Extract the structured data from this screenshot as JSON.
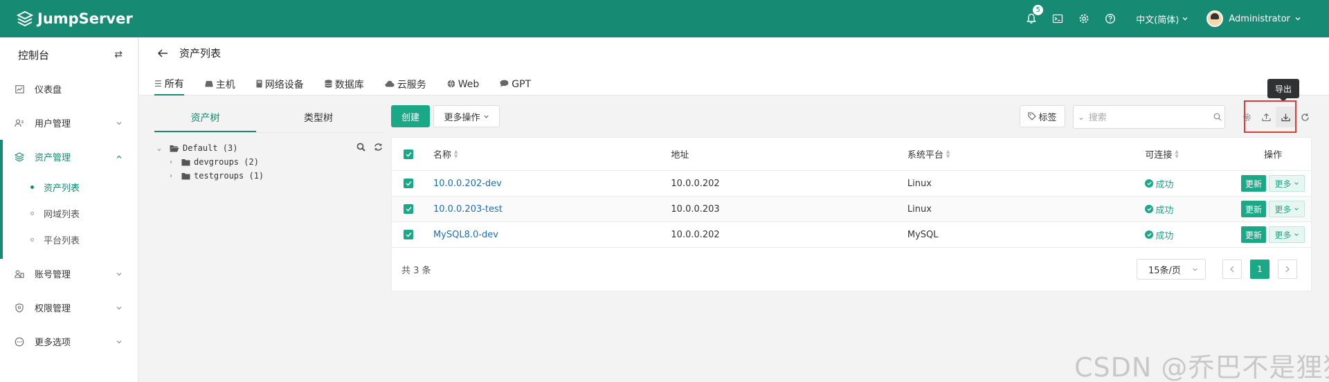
{
  "header": {
    "logo": "JumpServer",
    "notification_count": "5",
    "language": "中文(简体)",
    "user": "Administrator",
    "icons": [
      "bell-icon",
      "terminal-icon",
      "gear-icon",
      "help-icon"
    ]
  },
  "sidebar": {
    "title": "控制台",
    "items": [
      {
        "label": "仪表盘",
        "icon": "dashboard-icon"
      },
      {
        "label": "用户管理",
        "icon": "users-icon"
      },
      {
        "label": "资产管理",
        "icon": "assets-icon"
      },
      {
        "label": "账号管理",
        "icon": "accounts-icon"
      },
      {
        "label": "权限管理",
        "icon": "shield-icon"
      },
      {
        "label": "更多选项",
        "icon": "more-icon"
      }
    ],
    "sub_items": [
      {
        "label": "资产列表"
      },
      {
        "label": "网域列表"
      },
      {
        "label": "平台列表"
      }
    ]
  },
  "page": {
    "title": "资产列表",
    "tabs": [
      {
        "label": "所有"
      },
      {
        "label": "主机"
      },
      {
        "label": "网络设备"
      },
      {
        "label": "数据库"
      },
      {
        "label": "云服务"
      },
      {
        "label": "Web"
      },
      {
        "label": "GPT"
      }
    ]
  },
  "tree": {
    "tab_asset": "资产树",
    "tab_type": "类型树",
    "root": "Default (3)",
    "children": [
      "devgroups (2)",
      "testgroups (1)"
    ]
  },
  "toolbar": {
    "create": "创建",
    "more_ops": "更多操作",
    "tag": "标签",
    "search_placeholder": "搜索",
    "export_tooltip": "导出"
  },
  "table": {
    "headers": {
      "name": "名称",
      "address": "地址",
      "platform": "系统平台",
      "connectivity": "可连接",
      "actions": "操作"
    },
    "rows": [
      {
        "name": "10.0.0.202-dev",
        "address": "10.0.0.202",
        "platform": "Linux",
        "status": "成功"
      },
      {
        "name": "10.0.0.203-test",
        "address": "10.0.0.203",
        "platform": "Linux",
        "status": "成功"
      },
      {
        "name": "MySQL8.0-dev",
        "address": "10.0.0.202",
        "platform": "MySQL",
        "status": "成功"
      }
    ],
    "action_refresh": "更新",
    "action_more": "更多"
  },
  "pagination": {
    "total": "共 3 条",
    "page_size": "15条/页",
    "current_page": "1"
  },
  "watermark": "CSDN @乔巴不是狸猫",
  "colors": {
    "brand": "#178a73",
    "accent": "#1ba886",
    "highlight": "#e53935"
  }
}
